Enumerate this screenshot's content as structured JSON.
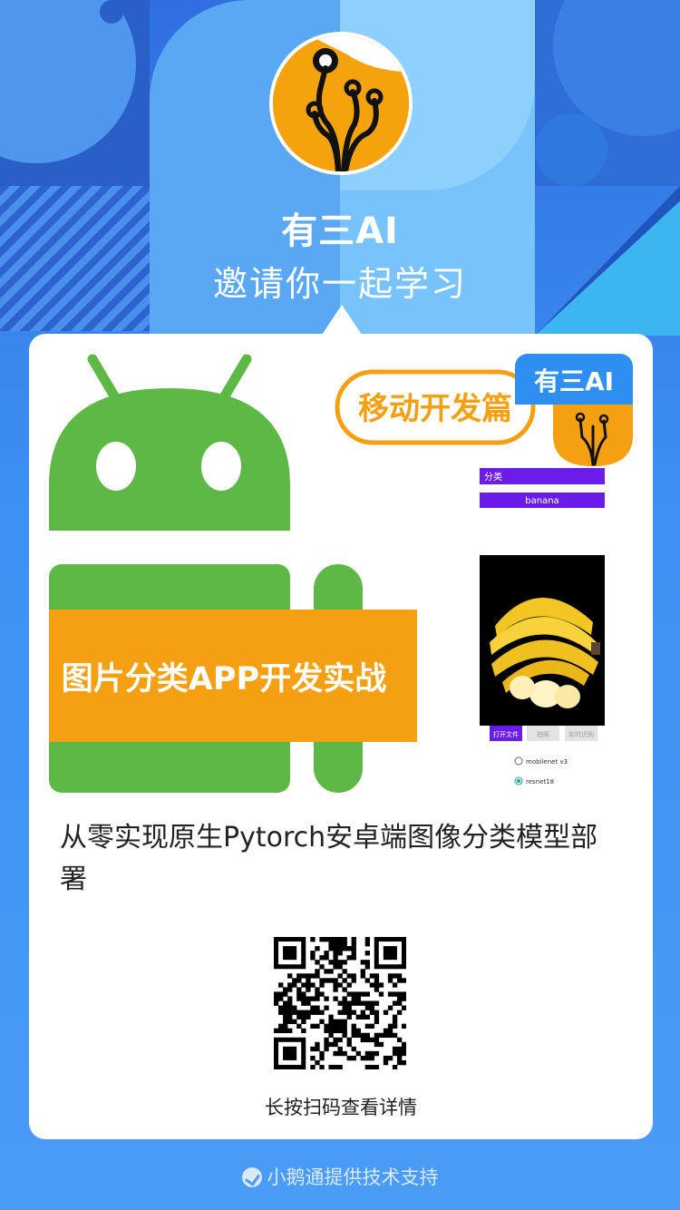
{
  "header": {
    "brand": "有三AI",
    "invite": "邀请你一起学习"
  },
  "poster": {
    "series_badge": "移动开发篇",
    "corner_tag": "有三AI",
    "banner": "图片分类APP开发实战",
    "app_mock": {
      "label_box": "分类",
      "result_box": "banana",
      "buttons": [
        "打开文件",
        "拍照",
        "实时识别"
      ],
      "models": [
        "mobilenet v3",
        "resnet18"
      ],
      "selected_model_index": 1
    }
  },
  "course": {
    "title": "从零实现原生Pytorch安卓端图像分类模型部署"
  },
  "qr": {
    "hint": "长按扫码查看详情"
  },
  "footer": {
    "text": "小鹅通提供技术支持"
  },
  "colors": {
    "android_green": "#5db845",
    "banner_orange": "#f5a012",
    "brand_blue": "#2f8ff0",
    "app_purple": "#6a1de8"
  }
}
